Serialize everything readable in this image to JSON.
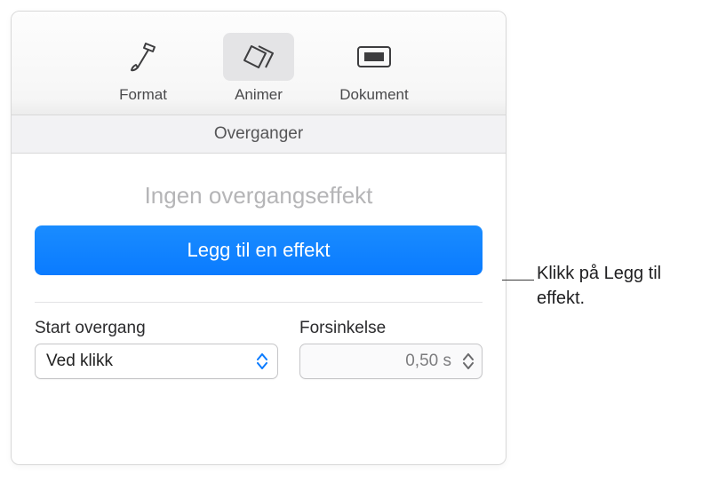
{
  "toolbar": {
    "format_label": "Format",
    "animate_label": "Animer",
    "document_label": "Dokument"
  },
  "section_title": "Overganger",
  "no_effect_text": "Ingen overgangseffekt",
  "add_effect_label": "Legg til en effekt",
  "start_transition_label": "Start overgang",
  "start_transition_value": "Ved klikk",
  "delay_label": "Forsinkelse",
  "delay_value": "0,50 s",
  "callout": "Klikk på Legg til effekt."
}
